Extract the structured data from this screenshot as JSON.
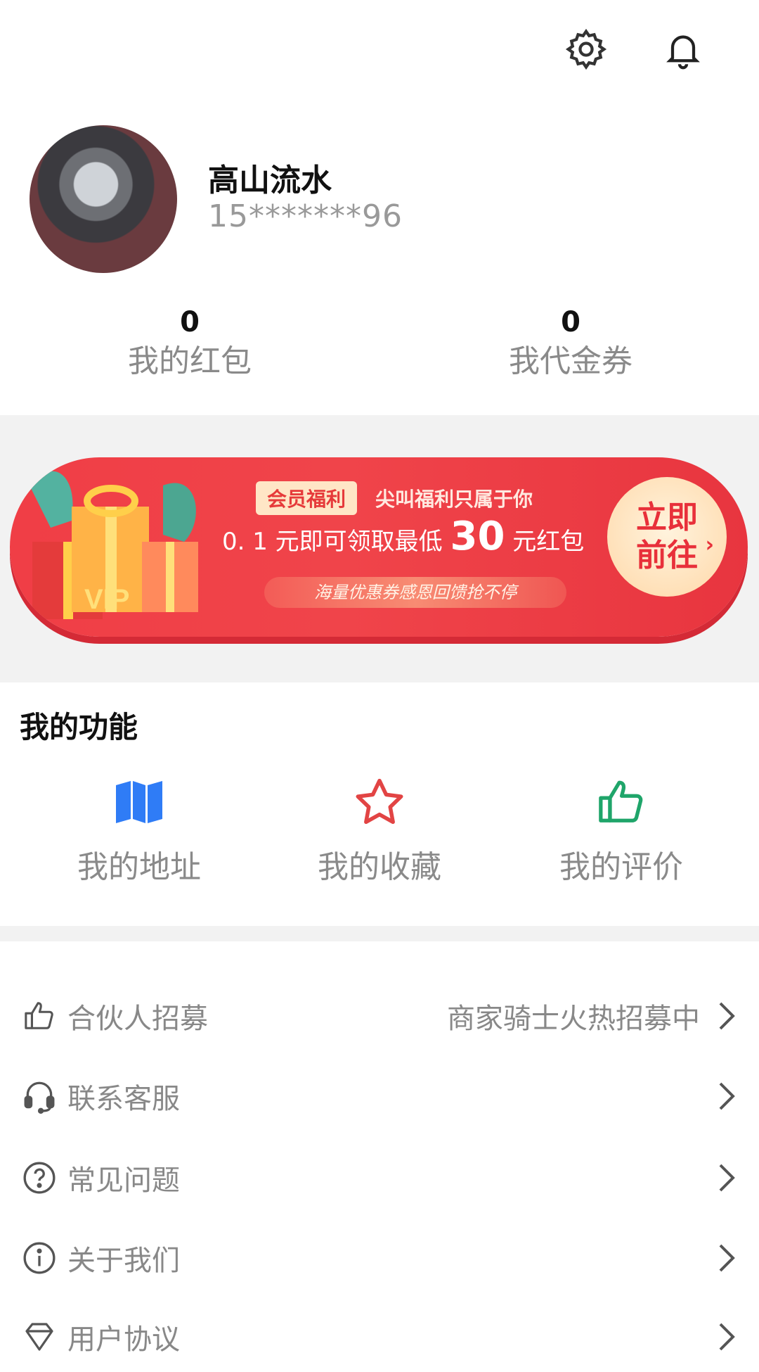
{
  "profile": {
    "username": "高山流水",
    "phone": "15*******96"
  },
  "stats": [
    {
      "value": "0",
      "label": "我的红包"
    },
    {
      "value": "0",
      "label": "我代金券"
    }
  ],
  "banner": {
    "badge": "会员福利",
    "tagline": "尖叫福利只属于你",
    "line_prefix": "0. 1 元即可领取最低",
    "line_amount": "30",
    "line_suffix": "元红包",
    "subline": "海量优惠券感恩回馈抢不停",
    "button_line1": "立即",
    "button_line2": "前往",
    "gift_text": "VIP",
    "colors": {
      "main": "#f03e46",
      "button_text": "#e8303a"
    }
  },
  "functions": {
    "title": "我的功能",
    "items": [
      {
        "label": "我的地址",
        "icon": "map-icon",
        "color": "#2f7cf6"
      },
      {
        "label": "我的收藏",
        "icon": "star-icon",
        "color": "#e24444"
      },
      {
        "label": "我的评价",
        "icon": "thumbs-up-icon",
        "color": "#1fa56a"
      }
    ]
  },
  "menu": [
    {
      "label": "合伙人招募",
      "hint": "商家骑士火热招募中",
      "icon": "thumbs-up-icon"
    },
    {
      "label": "联系客服",
      "hint": "",
      "icon": "headset-icon"
    },
    {
      "label": "常见问题",
      "hint": "",
      "icon": "question-icon"
    },
    {
      "label": "关于我们",
      "hint": "",
      "icon": "info-icon"
    },
    {
      "label": "用户协议",
      "hint": "",
      "icon": "diamond-icon"
    }
  ]
}
